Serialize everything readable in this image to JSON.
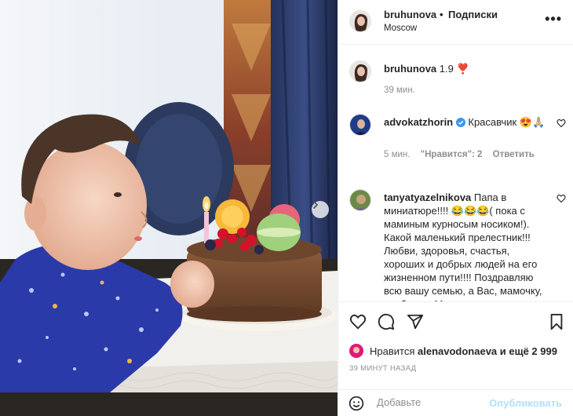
{
  "post": {
    "username": "bruhunova",
    "separator": "•",
    "follow_label": "Подписки",
    "location": "Moscow",
    "more_label": "•••"
  },
  "caption": {
    "username": "bruhunova",
    "text": "1.9 ❣️",
    "time": "39 мин."
  },
  "comments": [
    {
      "username": "advokatzhorin",
      "text": "Красавчик 😍🙏🏼",
      "time": "5 мин.",
      "likes": "\"Нравится\": 2",
      "reply": "Ответить"
    },
    {
      "username": "tanyatyazelnikova",
      "text": "Папа в миниатюре!!!! 😂😂😂( пока с маминым курносым носиком!). Какой маленький прелестник!!! Любви, здоровья, счастья, хороших и добрых людей на его жизненном пути!!!! Поздравляю всю вашу семью, а Вас, мамочку, особенно. Мне"
    }
  ],
  "likes": {
    "prefix": "Нравится",
    "user": "alenavodonaeva",
    "suffix": "и ещё 2 999"
  },
  "timestamp": "39 МИНУТ НАЗАД",
  "add_comment": {
    "placeholder": "Добавьте",
    "post_label": "Опубликовать"
  },
  "icons": [
    "next-arrow-icon",
    "heart-icon",
    "comment-icon",
    "share-icon",
    "bookmark-icon",
    "emoji-icon",
    "verified-icon"
  ]
}
